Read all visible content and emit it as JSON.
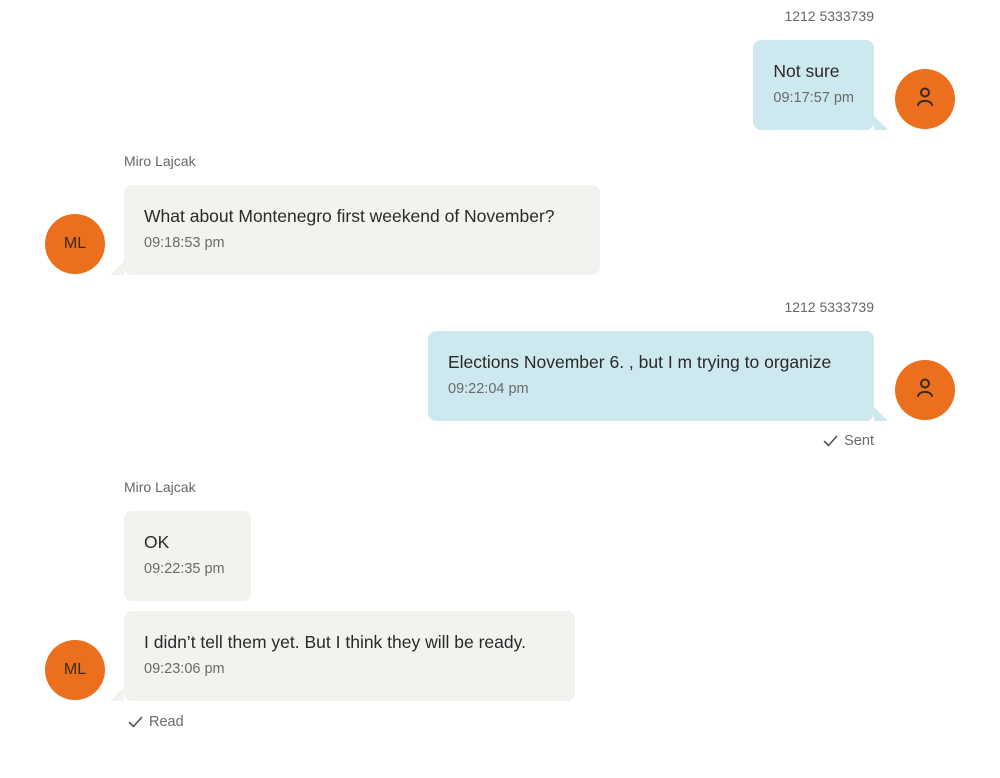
{
  "conversation": {
    "messages": [
      {
        "direction": "out",
        "sender": "1212 5333739",
        "text": "Not sure",
        "time": "09:17:57 pm"
      },
      {
        "direction": "in",
        "sender": "Miro Lajcak",
        "avatar_initials": "ML",
        "text": "What about Montenegro first weekend of November?",
        "time": "09:18:53 pm"
      },
      {
        "direction": "out",
        "sender": "1212 5333739",
        "text": "Elections November 6. ,  but I m trying to organize",
        "time": "09:22:04 pm",
        "status": "Sent"
      },
      {
        "direction": "in",
        "sender": "Miro Lajcak",
        "text": "OK",
        "time": "09:22:35 pm"
      },
      {
        "direction": "in",
        "avatar_initials": "ML",
        "text": "I didn’t tell them yet. But I think they will be ready.",
        "time": "09:23:06 pm",
        "status": "Read"
      }
    ]
  },
  "icons": {
    "user_avatar": "person-icon",
    "status": "checkmark-icon"
  },
  "colors": {
    "outgoing_bubble": "#cde8ee",
    "incoming_bubble": "#f3f2ef",
    "avatar": "#ec6f1e"
  }
}
